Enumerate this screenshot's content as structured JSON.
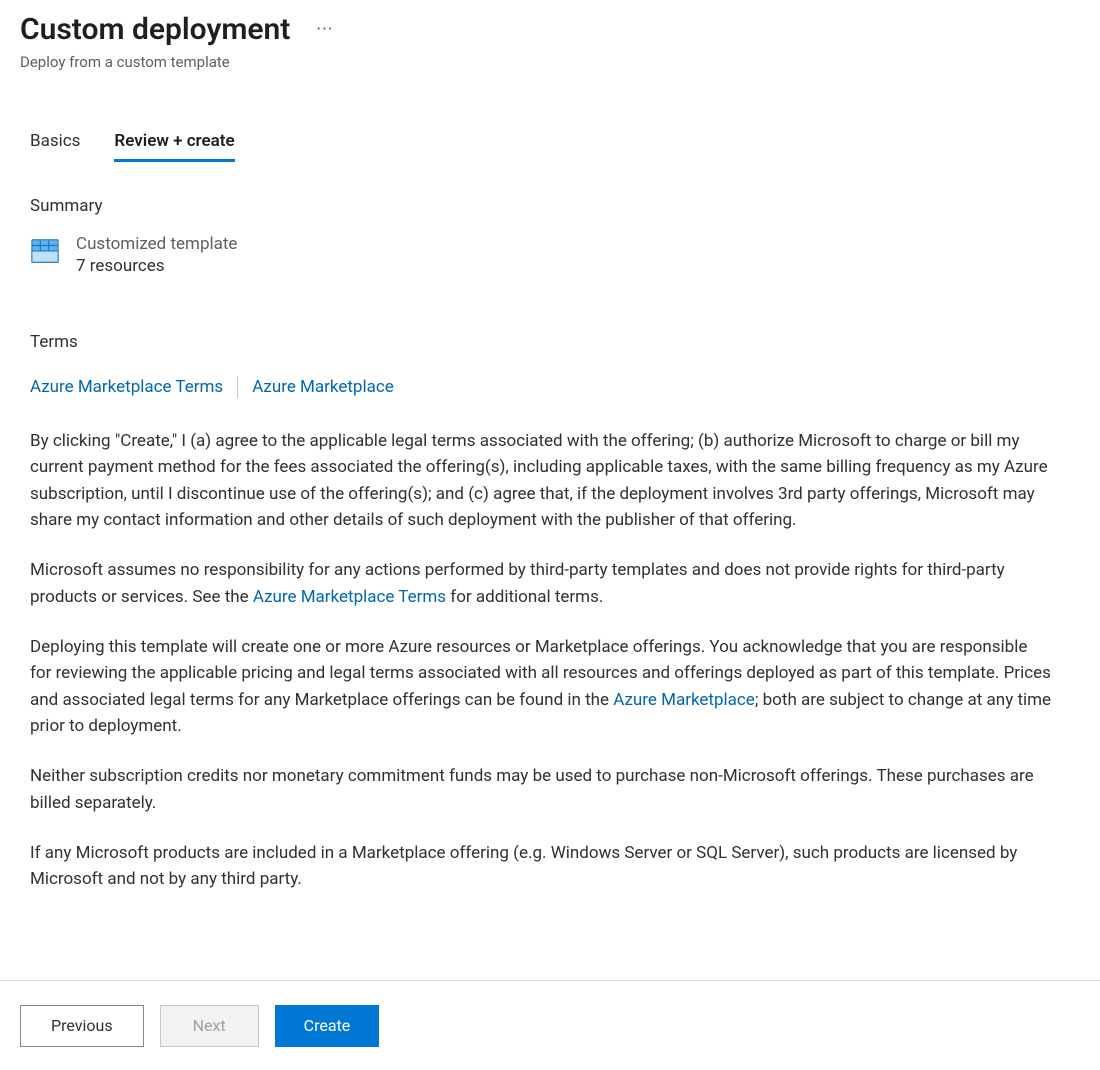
{
  "header": {
    "title": "Custom deployment",
    "subtitle": "Deploy from a custom template",
    "more_aria": "More options"
  },
  "tabs": {
    "basics": "Basics",
    "review_create": "Review + create"
  },
  "summary": {
    "heading": "Summary",
    "template_label": "Customized template",
    "resource_count": "7 resources"
  },
  "terms": {
    "heading": "Terms",
    "link_terms": "Azure Marketplace Terms",
    "link_marketplace": "Azure Marketplace",
    "para1": "By clicking \"Create,\" I (a) agree to the applicable legal terms associated with the offering; (b) authorize Microsoft to charge or bill my current payment method for the fees associated the offering(s), including applicable taxes, with the same billing frequency as my Azure subscription, until I discontinue use of the offering(s); and (c) agree that, if the deployment involves 3rd party offerings, Microsoft may share my contact information and other details of such deployment with the publisher of that offering.",
    "para2_pre": "Microsoft assumes no responsibility for any actions performed by third-party templates and does not provide rights for third-party products or services. See the ",
    "para2_link": "Azure Marketplace Terms",
    "para2_post": " for additional terms.",
    "para3_pre": "Deploying this template will create one or more Azure resources or Marketplace offerings.  You acknowledge that you are responsible for reviewing the applicable pricing and legal terms associated with all resources and offerings deployed as part of this template.  Prices and associated legal terms for any Marketplace offerings can be found in the ",
    "para3_link": "Azure Marketplace",
    "para3_post": "; both are subject to change at any time prior to deployment.",
    "para4": "Neither subscription credits nor monetary commitment funds may be used to purchase non-Microsoft offerings. These purchases are billed separately.",
    "para5": "If any Microsoft products are included in a Marketplace offering (e.g. Windows Server or SQL Server), such products are licensed by Microsoft and not by any third party."
  },
  "footer": {
    "previous": "Previous",
    "next": "Next",
    "create": "Create"
  },
  "colors": {
    "link": "#0066b4",
    "primary": "#0078d4"
  }
}
